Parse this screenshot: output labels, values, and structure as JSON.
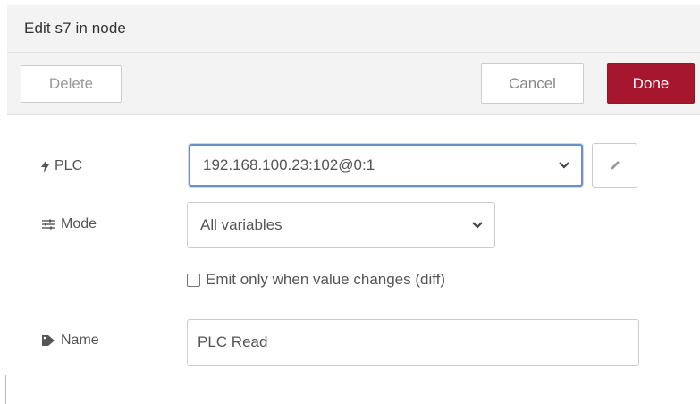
{
  "header": {
    "title": "Edit s7 in node"
  },
  "toolbar": {
    "delete_label": "Delete",
    "cancel_label": "Cancel",
    "done_label": "Done",
    "done_color": "#a6172d"
  },
  "form": {
    "plc": {
      "label": "PLC",
      "icon": "bolt-icon",
      "value": "192.168.100.23:102@0:1"
    },
    "mode": {
      "label": "Mode",
      "icon": "sliders-icon",
      "value": "All variables"
    },
    "diff": {
      "label": "Emit only when value changes (diff)",
      "checked": false
    },
    "name": {
      "label": "Name",
      "icon": "tag-icon",
      "value": "PLC Read"
    }
  }
}
